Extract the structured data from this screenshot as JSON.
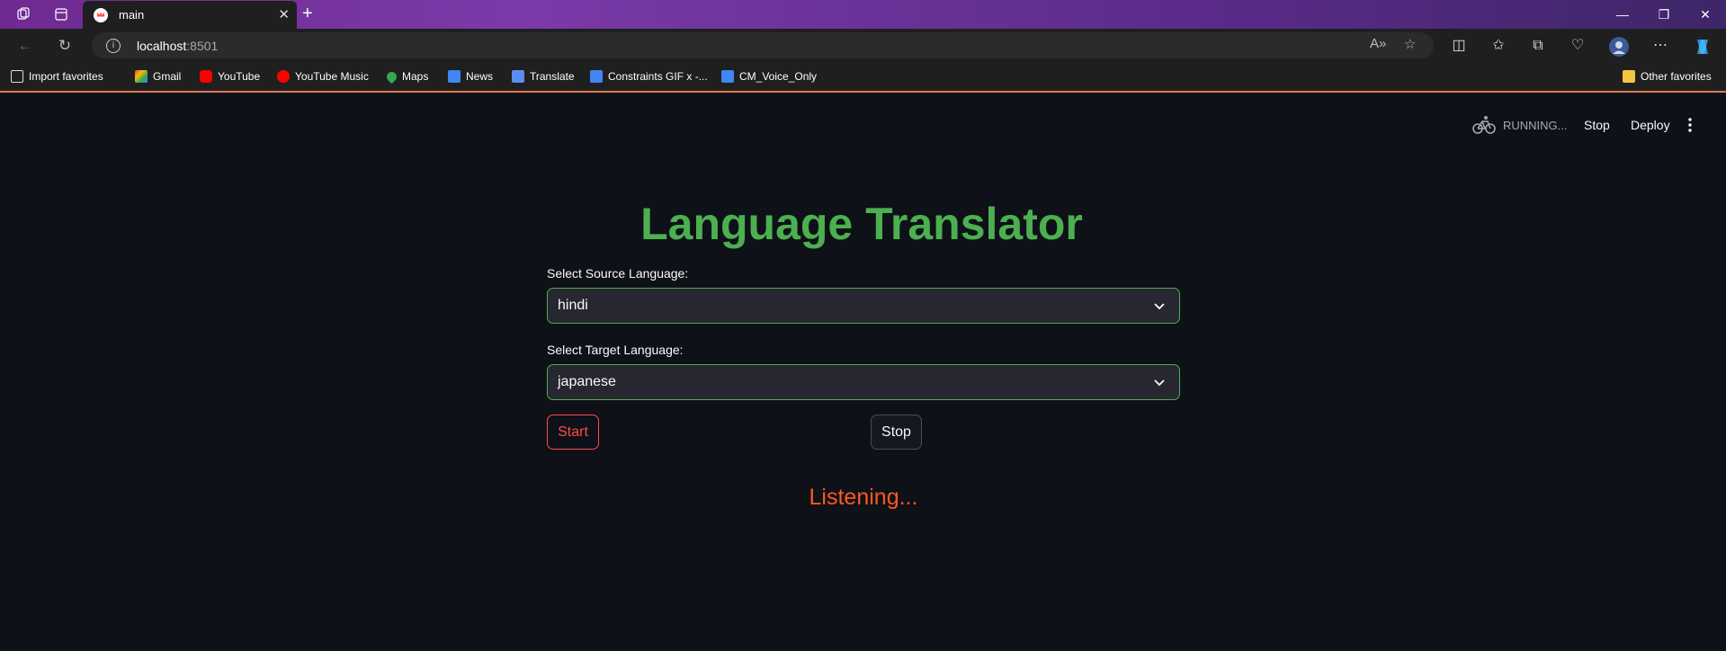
{
  "browser": {
    "tab_title": "main",
    "url_host": "localhost",
    "url_port": ":8501",
    "bookmarks": [
      {
        "label": "Import favorites",
        "icon": "import-icon"
      },
      {
        "label": "Gmail",
        "icon": "gmail-icon"
      },
      {
        "label": "YouTube",
        "icon": "youtube-icon"
      },
      {
        "label": "YouTube Music",
        "icon": "youtube-music-icon"
      },
      {
        "label": "Maps",
        "icon": "maps-icon"
      },
      {
        "label": "News",
        "icon": "news-icon"
      },
      {
        "label": "Translate",
        "icon": "translate-icon"
      },
      {
        "label": "Constraints GIF x -...",
        "icon": "docs-icon"
      },
      {
        "label": "CM_Voice_Only",
        "icon": "docs-icon"
      }
    ],
    "other_favorites": "Other favorites"
  },
  "streamlit_header": {
    "status": "RUNNING...",
    "stop_label": "Stop",
    "deploy_label": "Deploy"
  },
  "app": {
    "title": "Language Translator",
    "source": {
      "label": "Select Source Language:",
      "value": "hindi"
    },
    "target": {
      "label": "Select Target Language:",
      "value": "japanese"
    },
    "start_label": "Start",
    "stop_label": "Stop",
    "status_text": "Listening..."
  },
  "colors": {
    "title": "#4caf50",
    "select_border": "#4caf50",
    "start": "#ff4b4b",
    "status": "#ff5722",
    "background": "#0e1117"
  }
}
